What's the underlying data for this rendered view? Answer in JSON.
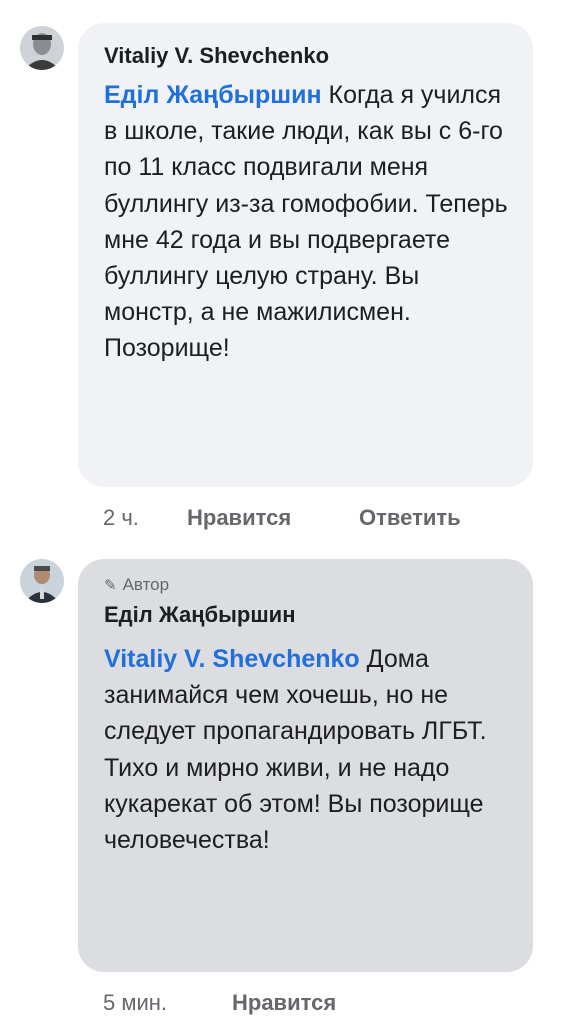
{
  "comments": [
    {
      "author": "Vitaliy V. Shevchenko",
      "mention": "Едiл Жаңбыршин",
      "text": " Когда я учился в школе, такие люди, как вы с 6-го по 11 класс подвигали меня буллингу из-за гомофобии. Теперь мне 42 года и вы подвергаете буллингу целую страну. Вы монстр, а не мажилисмен. Позорище!",
      "time": "2 ч.",
      "like_label": "Нравится",
      "reply_label": "Ответить"
    },
    {
      "author_tag": "Автор",
      "author": "Едiл Жаңбыршин",
      "mention": "Vitaliy V. Shevchenko",
      "text": " Дома занимайся чем хочешь, но не следует пропагандировать ЛГБТ. Тихо и мирно живи, и не надо кукарекат об этом! Вы позорище человечества!",
      "time": "5 мин.",
      "like_label": "Нравится"
    }
  ]
}
